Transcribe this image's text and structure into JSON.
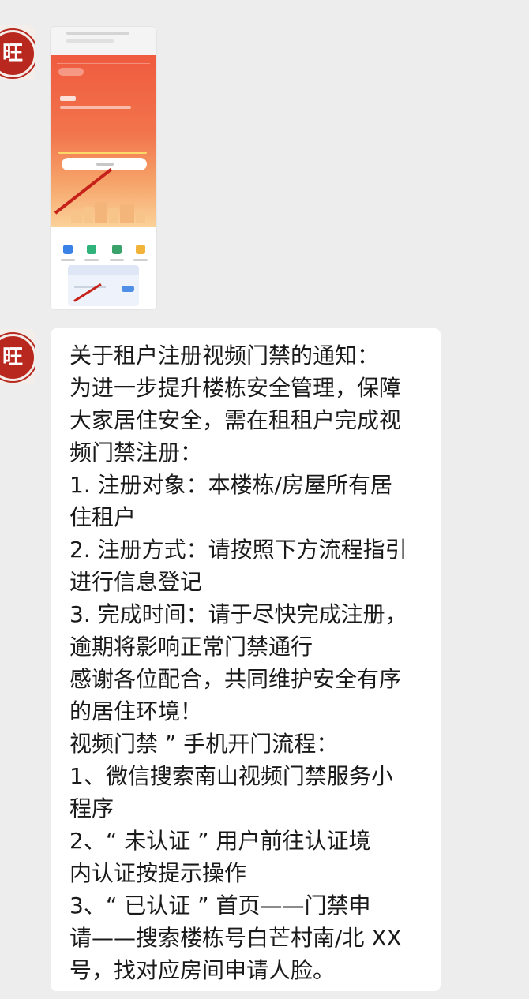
{
  "chat": {
    "sender_avatar_text": "旺",
    "image_message": {
      "alt": ""
    },
    "text_message": {
      "lines": [
        "关于租户注册视频门禁的通知：",
        "为进一步提升楼栋安全管理，保障",
        "大家居住安全，需在租租户完成视",
        "频门禁注册：",
        "1. 注册对象：本楼栋/房屋所有居",
        "住租户",
        "2. 注册方式：请按照下方流程指引",
        "进行信息登记",
        "3. 完成时间：请于尽快完成注册，",
        "逾期将影响正常门禁通行",
        "感谢各位配合，共同维护安全有序",
        "的居住环境！",
        "视频门禁 ” 手机开门流程：",
        "1、微信搜索南山视频门禁服务小",
        "程序",
        "2、“ 未认证 ” 用户前往认证境",
        "内认证按提示操作",
        "3、“ 已认证 ” 首页——门禁申",
        "请——搜索楼栋号白芒村南/北 XX",
        "号，找对应房间申请人脸。"
      ]
    }
  },
  "colors": {
    "chat_background": "#ededed",
    "bubble": "#ffffff",
    "avatar_seal": "#b8281e",
    "banner_top": "#ef5b3f",
    "banner_bottom": "#fbd29a"
  }
}
